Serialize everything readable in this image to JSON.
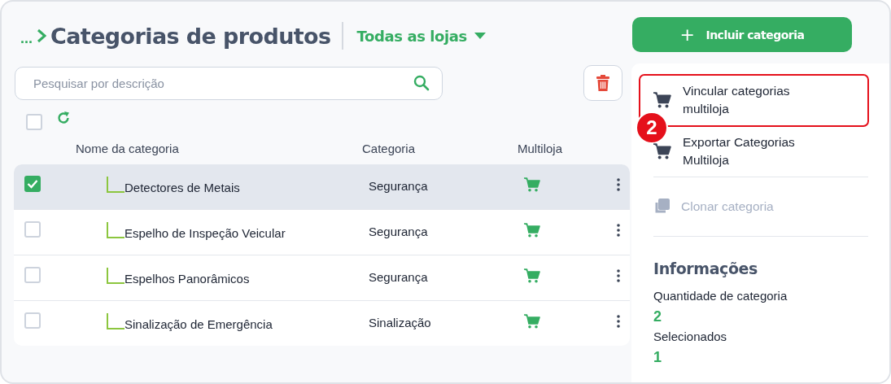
{
  "breadcrumb": {
    "ellipsis": "...",
    "title": "Categorias de produtos",
    "store_filter": "Todas as lojas"
  },
  "search": {
    "placeholder": "Pesquisar por descrição"
  },
  "select_all": {
    "checked": false
  },
  "table": {
    "columns": [
      "Nome da categoria",
      "Categoria",
      "Multiloja"
    ],
    "rows": [
      {
        "name": "Detectores de Metais",
        "category": "Segurança",
        "checked": true
      },
      {
        "name": "Espelho de Inspeção Veicular",
        "category": "Segurança",
        "checked": false
      },
      {
        "name": "Espelhos Panorâmicos",
        "category": "Segurança",
        "checked": false
      },
      {
        "name": "Sinalização de Emergência",
        "category": "Sinalização",
        "checked": false
      }
    ]
  },
  "add_button": {
    "icon": "+",
    "label": "Incluir categoria"
  },
  "actions": [
    {
      "kind": "cart",
      "label": "Vincular categorias multiloja",
      "disabled": false,
      "highlighted": true,
      "badge": "2"
    },
    {
      "kind": "cart",
      "label": "Exportar Categorias Multiloja",
      "disabled": false,
      "highlighted": false
    },
    {
      "kind": "clone",
      "label": "Clonar categoria",
      "disabled": true,
      "highlighted": false
    }
  ],
  "info": {
    "title": "Informações",
    "stats": [
      {
        "label": "Quantidade de categoria",
        "value": "2"
      },
      {
        "label": "Selecionados",
        "value": "1"
      }
    ]
  }
}
